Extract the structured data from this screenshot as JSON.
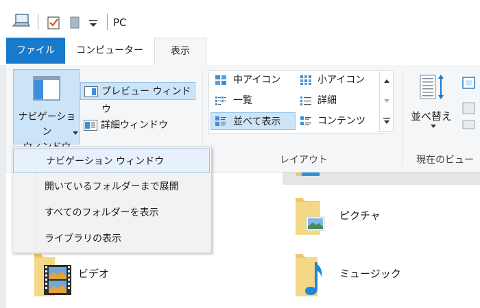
{
  "window": {
    "title": "PC"
  },
  "tabs": [
    {
      "label": "ファイル"
    },
    {
      "label": "コンピューター"
    },
    {
      "label": "表示"
    }
  ],
  "ribbon": {
    "panes": {
      "nav_pane_line1": "ナビゲーション",
      "nav_pane_line2": "ウィンドウ",
      "preview_label": "プレビュー ウィンドウ",
      "details_label": "詳細ウィンドウ"
    },
    "layout": {
      "items": [
        {
          "label": "中アイコン"
        },
        {
          "label": "小アイコン"
        },
        {
          "label": "一覧"
        },
        {
          "label": "詳細"
        },
        {
          "label": "並べて表示"
        },
        {
          "label": "コンテンツ"
        }
      ],
      "selected": "並べて表示",
      "group_label": "レイアウト"
    },
    "current_view": {
      "sort_label": "並べ替え",
      "group_label": "現在のビュー"
    }
  },
  "dropdown": {
    "items": [
      {
        "label": "ナビゲーション ウィンドウ"
      },
      {
        "label": "開いているフォルダーまで展開"
      },
      {
        "label": "すべてのフォルダーを表示"
      },
      {
        "label": "ライブラリの表示"
      }
    ]
  },
  "content": {
    "folders": [
      {
        "label": "ピクチャ",
        "icon": "pictures-folder-icon"
      },
      {
        "label": "ビデオ",
        "icon": "videos-folder-icon"
      },
      {
        "label": "ミュージック",
        "icon": "music-folder-icon"
      }
    ]
  },
  "colors": {
    "accent": "#1979ca",
    "selected_bg": "#cce4f7",
    "selected_border": "#98c1e6"
  }
}
